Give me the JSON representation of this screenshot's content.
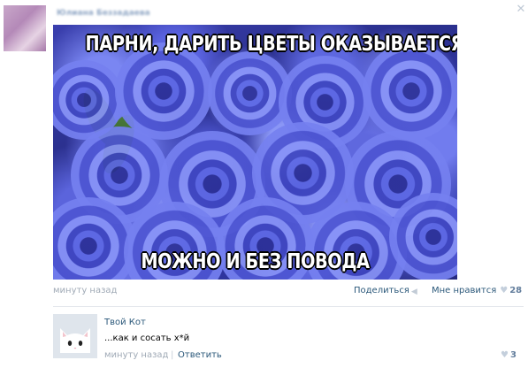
{
  "post": {
    "author_name": "Юлиана Беззадаева",
    "meme": {
      "top_text": "ПАРНИ, ДАРИТЬ ЦВЕТЫ ОКАЗЫВАЕТСЯ",
      "bottom_text": "МОЖНО И БЕЗ ПОВОДА"
    },
    "time": "минуту назад",
    "share_label": "Поделиться",
    "like_label": "Мне нравится",
    "like_count": "28",
    "close_icon": "close-icon",
    "share_icon": "megaphone-icon",
    "heart_icon": "heart-icon"
  },
  "comment": {
    "author": "Твой Кот",
    "text": "...как и сосать х*й",
    "time": "минуту назад",
    "separator": "|",
    "reply_label": "Ответить",
    "like_count": "3",
    "avatar_icon": "cat-avatar"
  },
  "colors": {
    "link": "#2b587a",
    "muted": "#a0aab6",
    "heart": "#c4cfdc"
  }
}
